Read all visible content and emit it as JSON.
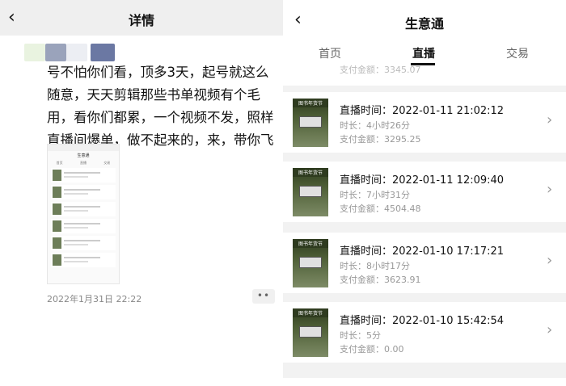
{
  "left": {
    "header": {
      "back_icon": "chevron-left-icon",
      "title": "详情"
    },
    "post_text": "号不怕你们看，顶多3天，起号就这么随意，天天剪辑那些书单视频有个毛用，看你们都累，一个视频不发，照样直播间爆单，做不起来的，来，带你飞",
    "thumbnail": {
      "title": "生意通",
      "tabs": [
        "首页",
        "直播",
        "交易"
      ]
    },
    "timestamp": "2022年1月31日 22:22",
    "more_icon": "more-dots-icon"
  },
  "right": {
    "header": {
      "back_icon": "chevron-left-icon",
      "title": "生意通"
    },
    "tabs": [
      {
        "label": "首页"
      },
      {
        "label": "直播",
        "active": true
      },
      {
        "label": "交易"
      }
    ],
    "partial_top_text": "支付金额：3345.07",
    "cover_banner_text": "图书年货节",
    "items": [
      {
        "time": "直播时间：2022-01-11 21:02:12",
        "duration": "时长：4小时26分",
        "amount": "支付金额：3295.25"
      },
      {
        "time": "直播时间：2022-01-11 12:09:40",
        "duration": "时长：7小时31分",
        "amount": "支付金额：4504.48"
      },
      {
        "time": "直播时间：2022-01-10 17:17:21",
        "duration": "时长：8小时17分",
        "amount": "支付金额：3623.91"
      },
      {
        "time": "直播时间：2022-01-10 15:42:54",
        "duration": "时长：5分",
        "amount": "支付金额：0.00"
      }
    ]
  }
}
